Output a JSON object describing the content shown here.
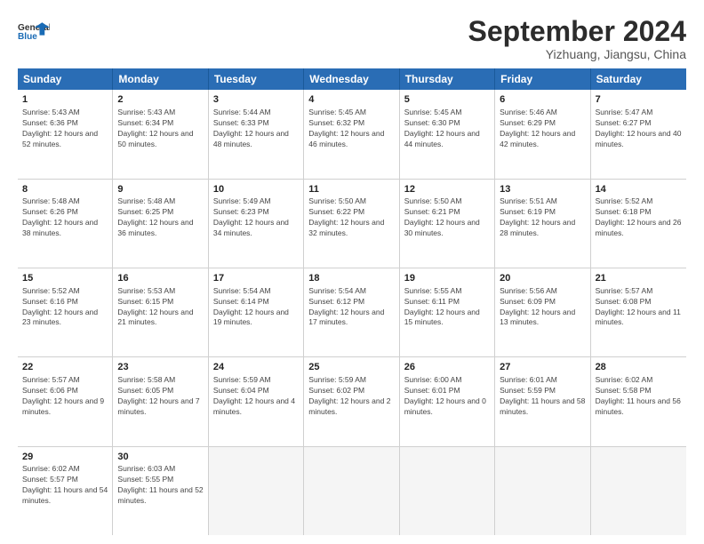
{
  "header": {
    "logo_general": "General",
    "logo_blue": "Blue",
    "month_title": "September 2024",
    "subtitle": "Yizhuang, Jiangsu, China"
  },
  "weekdays": [
    "Sunday",
    "Monday",
    "Tuesday",
    "Wednesday",
    "Thursday",
    "Friday",
    "Saturday"
  ],
  "rows": [
    [
      {
        "day": "1",
        "rise": "Sunrise: 5:43 AM",
        "set": "Sunset: 6:36 PM",
        "daylight": "Daylight: 12 hours and 52 minutes."
      },
      {
        "day": "2",
        "rise": "Sunrise: 5:43 AM",
        "set": "Sunset: 6:34 PM",
        "daylight": "Daylight: 12 hours and 50 minutes."
      },
      {
        "day": "3",
        "rise": "Sunrise: 5:44 AM",
        "set": "Sunset: 6:33 PM",
        "daylight": "Daylight: 12 hours and 48 minutes."
      },
      {
        "day": "4",
        "rise": "Sunrise: 5:45 AM",
        "set": "Sunset: 6:32 PM",
        "daylight": "Daylight: 12 hours and 46 minutes."
      },
      {
        "day": "5",
        "rise": "Sunrise: 5:45 AM",
        "set": "Sunset: 6:30 PM",
        "daylight": "Daylight: 12 hours and 44 minutes."
      },
      {
        "day": "6",
        "rise": "Sunrise: 5:46 AM",
        "set": "Sunset: 6:29 PM",
        "daylight": "Daylight: 12 hours and 42 minutes."
      },
      {
        "day": "7",
        "rise": "Sunrise: 5:47 AM",
        "set": "Sunset: 6:27 PM",
        "daylight": "Daylight: 12 hours and 40 minutes."
      }
    ],
    [
      {
        "day": "8",
        "rise": "Sunrise: 5:48 AM",
        "set": "Sunset: 6:26 PM",
        "daylight": "Daylight: 12 hours and 38 minutes."
      },
      {
        "day": "9",
        "rise": "Sunrise: 5:48 AM",
        "set": "Sunset: 6:25 PM",
        "daylight": "Daylight: 12 hours and 36 minutes."
      },
      {
        "day": "10",
        "rise": "Sunrise: 5:49 AM",
        "set": "Sunset: 6:23 PM",
        "daylight": "Daylight: 12 hours and 34 minutes."
      },
      {
        "day": "11",
        "rise": "Sunrise: 5:50 AM",
        "set": "Sunset: 6:22 PM",
        "daylight": "Daylight: 12 hours and 32 minutes."
      },
      {
        "day": "12",
        "rise": "Sunrise: 5:50 AM",
        "set": "Sunset: 6:21 PM",
        "daylight": "Daylight: 12 hours and 30 minutes."
      },
      {
        "day": "13",
        "rise": "Sunrise: 5:51 AM",
        "set": "Sunset: 6:19 PM",
        "daylight": "Daylight: 12 hours and 28 minutes."
      },
      {
        "day": "14",
        "rise": "Sunrise: 5:52 AM",
        "set": "Sunset: 6:18 PM",
        "daylight": "Daylight: 12 hours and 26 minutes."
      }
    ],
    [
      {
        "day": "15",
        "rise": "Sunrise: 5:52 AM",
        "set": "Sunset: 6:16 PM",
        "daylight": "Daylight: 12 hours and 23 minutes."
      },
      {
        "day": "16",
        "rise": "Sunrise: 5:53 AM",
        "set": "Sunset: 6:15 PM",
        "daylight": "Daylight: 12 hours and 21 minutes."
      },
      {
        "day": "17",
        "rise": "Sunrise: 5:54 AM",
        "set": "Sunset: 6:14 PM",
        "daylight": "Daylight: 12 hours and 19 minutes."
      },
      {
        "day": "18",
        "rise": "Sunrise: 5:54 AM",
        "set": "Sunset: 6:12 PM",
        "daylight": "Daylight: 12 hours and 17 minutes."
      },
      {
        "day": "19",
        "rise": "Sunrise: 5:55 AM",
        "set": "Sunset: 6:11 PM",
        "daylight": "Daylight: 12 hours and 15 minutes."
      },
      {
        "day": "20",
        "rise": "Sunrise: 5:56 AM",
        "set": "Sunset: 6:09 PM",
        "daylight": "Daylight: 12 hours and 13 minutes."
      },
      {
        "day": "21",
        "rise": "Sunrise: 5:57 AM",
        "set": "Sunset: 6:08 PM",
        "daylight": "Daylight: 12 hours and 11 minutes."
      }
    ],
    [
      {
        "day": "22",
        "rise": "Sunrise: 5:57 AM",
        "set": "Sunset: 6:06 PM",
        "daylight": "Daylight: 12 hours and 9 minutes."
      },
      {
        "day": "23",
        "rise": "Sunrise: 5:58 AM",
        "set": "Sunset: 6:05 PM",
        "daylight": "Daylight: 12 hours and 7 minutes."
      },
      {
        "day": "24",
        "rise": "Sunrise: 5:59 AM",
        "set": "Sunset: 6:04 PM",
        "daylight": "Daylight: 12 hours and 4 minutes."
      },
      {
        "day": "25",
        "rise": "Sunrise: 5:59 AM",
        "set": "Sunset: 6:02 PM",
        "daylight": "Daylight: 12 hours and 2 minutes."
      },
      {
        "day": "26",
        "rise": "Sunrise: 6:00 AM",
        "set": "Sunset: 6:01 PM",
        "daylight": "Daylight: 12 hours and 0 minutes."
      },
      {
        "day": "27",
        "rise": "Sunrise: 6:01 AM",
        "set": "Sunset: 5:59 PM",
        "daylight": "Daylight: 11 hours and 58 minutes."
      },
      {
        "day": "28",
        "rise": "Sunrise: 6:02 AM",
        "set": "Sunset: 5:58 PM",
        "daylight": "Daylight: 11 hours and 56 minutes."
      }
    ],
    [
      {
        "day": "29",
        "rise": "Sunrise: 6:02 AM",
        "set": "Sunset: 5:57 PM",
        "daylight": "Daylight: 11 hours and 54 minutes."
      },
      {
        "day": "30",
        "rise": "Sunrise: 6:03 AM",
        "set": "Sunset: 5:55 PM",
        "daylight": "Daylight: 11 hours and 52 minutes."
      },
      {
        "day": "",
        "rise": "",
        "set": "",
        "daylight": ""
      },
      {
        "day": "",
        "rise": "",
        "set": "",
        "daylight": ""
      },
      {
        "day": "",
        "rise": "",
        "set": "",
        "daylight": ""
      },
      {
        "day": "",
        "rise": "",
        "set": "",
        "daylight": ""
      },
      {
        "day": "",
        "rise": "",
        "set": "",
        "daylight": ""
      }
    ]
  ]
}
